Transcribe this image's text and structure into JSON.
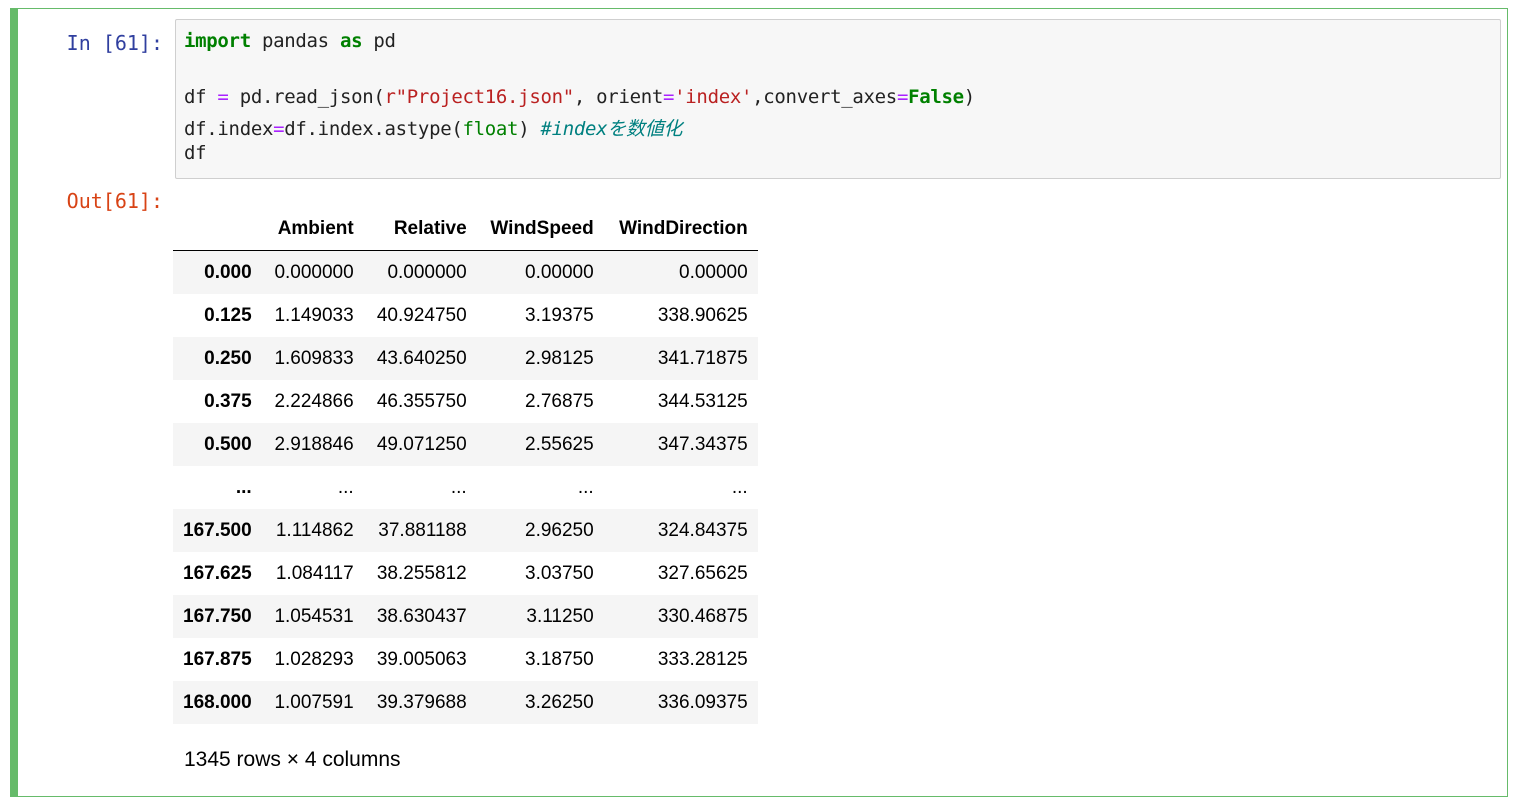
{
  "input_prompt": "In [61]:",
  "output_prompt": "Out[61]:",
  "code": {
    "line1": {
      "kw1": "import",
      "t1": " pandas ",
      "kw2": "as",
      "t2": " pd"
    },
    "line2": {
      "t1": "df ",
      "op1": "=",
      "t2": " pd.read_json(",
      "str1": "r\"Project16.json\"",
      "t3": ", orient",
      "op2": "=",
      "str2": "'index'",
      "t4": ",convert_axes",
      "op3": "=",
      "kw1": "False",
      "t5": ")"
    },
    "line3": {
      "t1": "df.index",
      "op1": "=",
      "t2": "df.index.astype(",
      "bi1": "float",
      "t3": ") ",
      "cm1": "#indexを数値化"
    },
    "line4": {
      "t1": "df"
    }
  },
  "table": {
    "columns": [
      "",
      "Ambient",
      "Relative",
      "WindSpeed",
      "WindDirection"
    ],
    "rows": [
      [
        "0.000",
        "0.000000",
        "0.000000",
        "0.00000",
        "0.00000"
      ],
      [
        "0.125",
        "1.149033",
        "40.924750",
        "3.19375",
        "338.90625"
      ],
      [
        "0.250",
        "1.609833",
        "43.640250",
        "2.98125",
        "341.71875"
      ],
      [
        "0.375",
        "2.224866",
        "46.355750",
        "2.76875",
        "344.53125"
      ],
      [
        "0.500",
        "2.918846",
        "49.071250",
        "2.55625",
        "347.34375"
      ],
      [
        "...",
        "...",
        "...",
        "...",
        "..."
      ],
      [
        "167.500",
        "1.114862",
        "37.881188",
        "2.96250",
        "324.84375"
      ],
      [
        "167.625",
        "1.084117",
        "38.255812",
        "3.03750",
        "327.65625"
      ],
      [
        "167.750",
        "1.054531",
        "38.630437",
        "3.11250",
        "330.46875"
      ],
      [
        "167.875",
        "1.028293",
        "39.005063",
        "3.18750",
        "333.28125"
      ],
      [
        "168.000",
        "1.007591",
        "39.379688",
        "3.26250",
        "336.09375"
      ]
    ]
  },
  "shape_text": "1345 rows × 4 columns",
  "colors": {
    "cell_border": "#66bb6a",
    "input_prompt": "#303f9f",
    "output_prompt": "#d84315",
    "keyword": "#008000",
    "operator": "#aa22ff",
    "string": "#ba2121",
    "comment": "#008080"
  }
}
